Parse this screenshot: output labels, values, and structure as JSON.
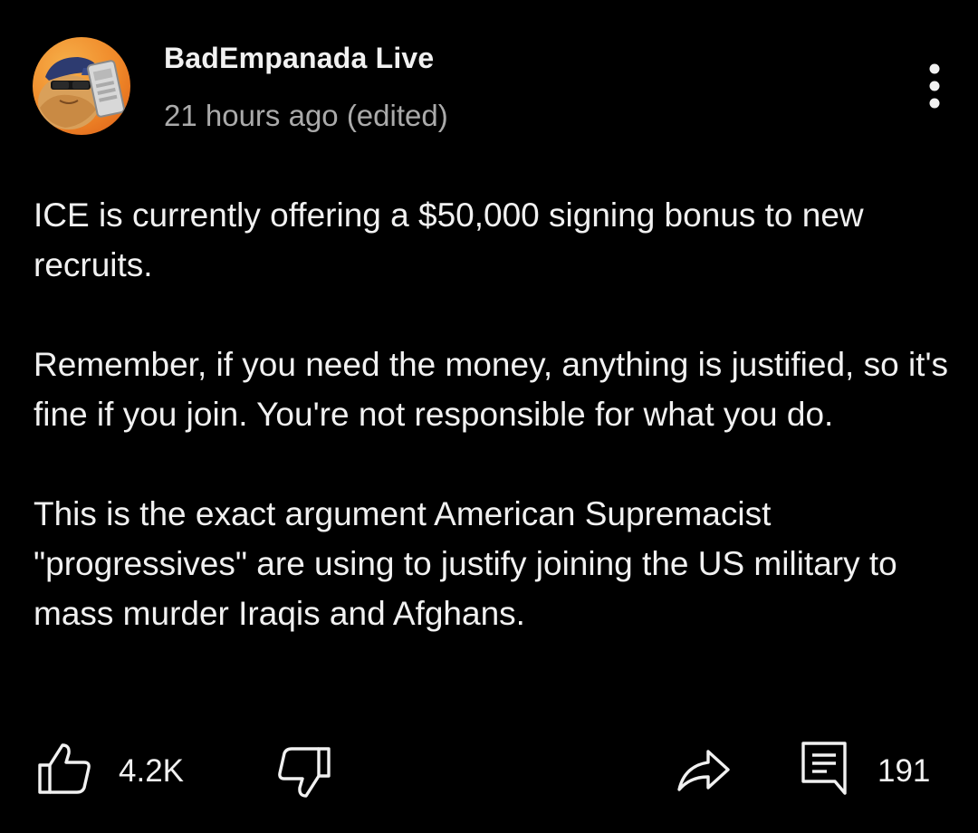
{
  "post": {
    "author": "BadEmpanada Live",
    "timestamp": "21 hours ago (edited)",
    "paragraphs": [
      "ICE is currently offering a $50,000 signing bonus to new recruits.",
      "Remember, if you need the money, anything is justified, so it's fine if you join. You're not responsible for what you do.",
      "This is the exact argument American Supremacist \"progressives\" are using to justify joining the US military to mass murder Iraqis and Afghans."
    ]
  },
  "actions": {
    "like_count": "4.2K",
    "comment_count": "191",
    "icons": [
      "like-icon",
      "dislike-icon",
      "share-icon",
      "comment-icon",
      "more-vert-icon"
    ]
  },
  "colors": {
    "background": "#000000",
    "primary_text": "#f1f1f1",
    "secondary_text": "#aaaaaa"
  }
}
